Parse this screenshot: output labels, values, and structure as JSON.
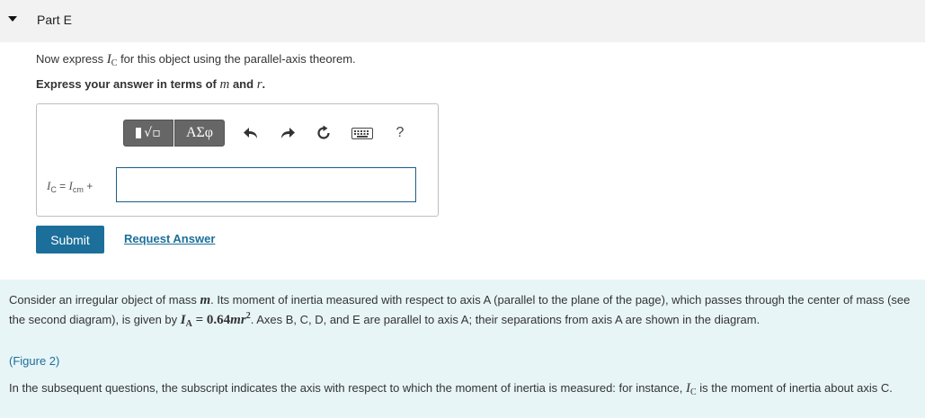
{
  "part": {
    "title": "Part E"
  },
  "question": {
    "prompt_prefix": "Now express",
    "prompt_var": "I",
    "prompt_var_sub": "C",
    "prompt_suffix": "for this object using the parallel-axis theorem.",
    "instruction_prefix": "Express your answer in terms of",
    "instruction_var1": "m",
    "instruction_mid": "and",
    "instruction_var2": "r",
    "instruction_end": "."
  },
  "toolbar": {
    "templates_label": "√▫",
    "symbols_label": "ΑΣφ",
    "help_label": "?"
  },
  "equation": {
    "lhs_var": "I",
    "lhs_sub": "C",
    "eq": " = ",
    "rhs_var": "I",
    "rhs_sub": "cm",
    "plus": " +",
    "input_value": ""
  },
  "actions": {
    "submit_label": "Submit",
    "request_label": "Request Answer"
  },
  "info": {
    "p1_a": "Consider an irregular object of mass",
    "p1_m": "m",
    "p1_b": ". Its moment of inertia measured with respect to axis A (parallel to the plane of the page), which passes through the center of mass (see the second diagram), is given by",
    "p1_I": "I",
    "p1_Isub": "A",
    "p1_eq": " = 0.64",
    "p1_mr": "mr",
    "p1_sup": "2",
    "p1_c": ". Axes B, C, D, and E are parallel to axis A; their separations from axis A are shown in the diagram.",
    "figure_link": "(Figure 2)",
    "p2_a": "In the subsequent questions, the subscript indicates the axis with respect to which the moment of inertia is measured: for instance,",
    "p2_I": "I",
    "p2_Isub": "C",
    "p2_b": "is the moment of inertia about axis C."
  }
}
